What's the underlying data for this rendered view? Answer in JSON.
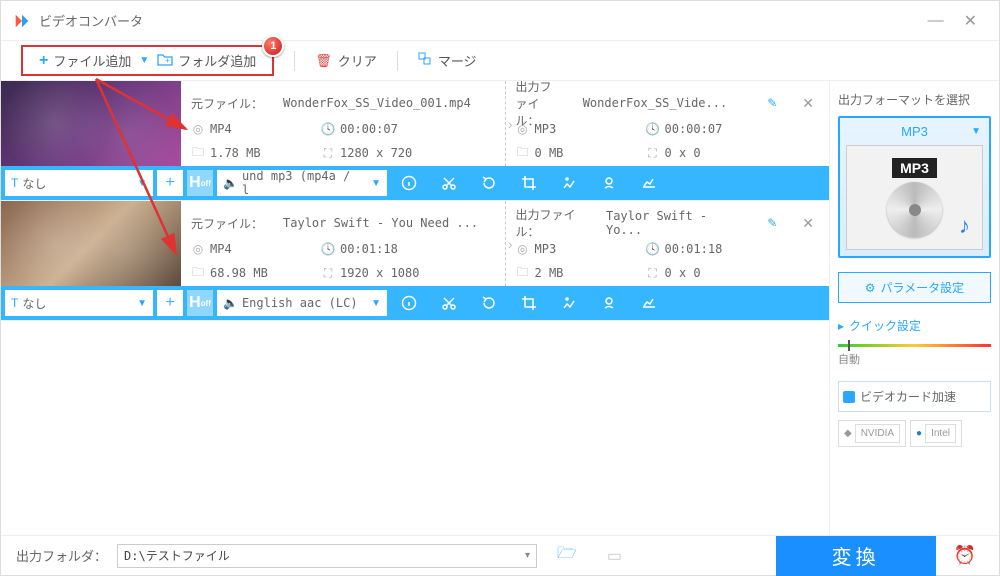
{
  "window": {
    "title": "ビデオコンバータ"
  },
  "toolbar": {
    "add_file": "ファイル追加",
    "add_folder": "フォルダ追加",
    "clear": "クリア",
    "merge": "マージ",
    "badge": "1"
  },
  "items": [
    {
      "src_label": "元ファイル：",
      "src_name": "WonderFox_SS_Video_001.mp4",
      "out_label": "出力ファイル：",
      "out_name": "WonderFox_SS_Vide...",
      "src_fmt": "MP4",
      "out_fmt": "MP3",
      "src_dur": "00:00:07",
      "out_dur": "00:00:07",
      "src_size": "1.78 MB",
      "out_size": "0 MB",
      "src_res": "1280 x 720",
      "out_res": "0 x 0",
      "sub": "なし",
      "audio": "und mp3 (mp4a / l"
    },
    {
      "src_label": "元ファイル：",
      "src_name": "Taylor Swift - You Need ...",
      "out_label": "出力ファイル：",
      "out_name": "Taylor Swift - Yo...",
      "src_fmt": "MP4",
      "out_fmt": "MP3",
      "src_dur": "00:01:18",
      "out_dur": "00:01:18",
      "src_size": "68.98 MB",
      "out_size": "2 MB",
      "src_res": "1920 x 1080",
      "out_res": "0 x 0",
      "sub": "なし",
      "audio": "English aac (LC)"
    }
  ],
  "side": {
    "title": "出力フォーマットを選択",
    "fmt_name": "MP3",
    "fmt_badge": "MP3",
    "param": "パラメータ設定",
    "quick": "クイック設定",
    "slider_label": "自動",
    "gpu": "ビデオカード加速",
    "nvidia": "NVIDIA",
    "intel": "Intel"
  },
  "bottom": {
    "label": "出力フォルダ：",
    "path": "D:\\テストファイル",
    "convert": "変換"
  }
}
